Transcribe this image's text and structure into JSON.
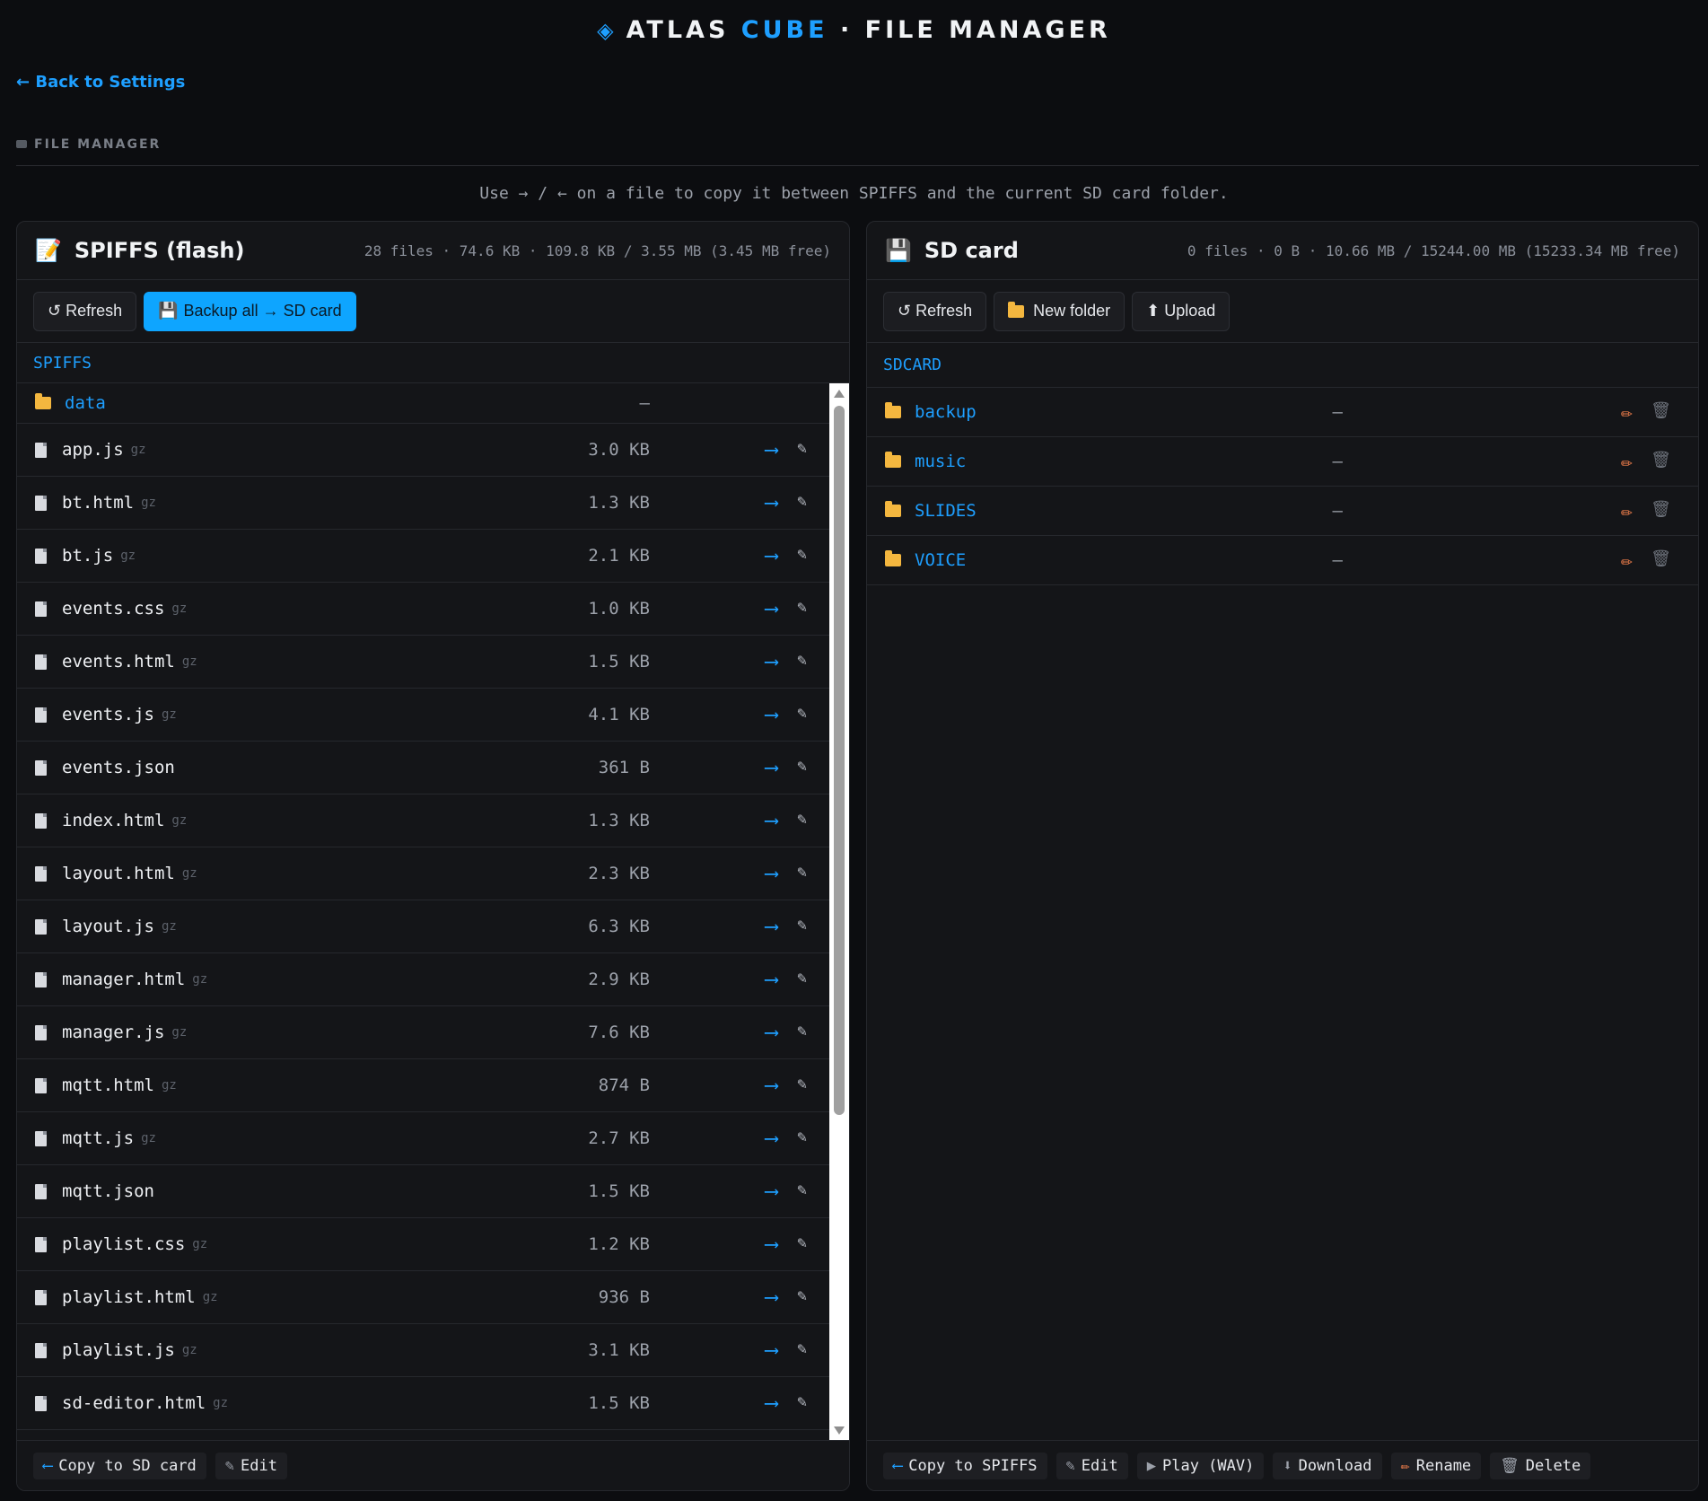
{
  "header": {
    "title_part1": "ATLAS",
    "title_accent": "CUBE",
    "title_part2": "· FILE MANAGER"
  },
  "nav": {
    "back_label": "← Back to Settings"
  },
  "section": {
    "label": "FILE MANAGER"
  },
  "hint": "Use → / ← on a file to copy it between SPIFFS and the current SD card folder.",
  "colors": {
    "accent": "#1e9fff",
    "primary_button": "#0ea5ff",
    "folder": "#f4b73f",
    "rename": "#f07e4b",
    "background": "#0c0d10"
  },
  "spiffs": {
    "title": "SPIFFS (flash)",
    "stats": "28 files · 74.6 KB · 109.8 KB / 3.55 MB (3.45 MB free)",
    "toolbar": {
      "refresh": "↺ Refresh",
      "backup": "Backup all → SD card"
    },
    "path": "SPIFFS",
    "folders": [
      {
        "name": "data",
        "size": "—"
      }
    ],
    "files": [
      {
        "name": "app.js",
        "tag": "gz",
        "size": "3.0 KB"
      },
      {
        "name": "bt.html",
        "tag": "gz",
        "size": "1.3 KB"
      },
      {
        "name": "bt.js",
        "tag": "gz",
        "size": "2.1 KB"
      },
      {
        "name": "events.css",
        "tag": "gz",
        "size": "1.0 KB"
      },
      {
        "name": "events.html",
        "tag": "gz",
        "size": "1.5 KB"
      },
      {
        "name": "events.js",
        "tag": "gz",
        "size": "4.1 KB"
      },
      {
        "name": "events.json",
        "tag": "",
        "size": "361 B"
      },
      {
        "name": "index.html",
        "tag": "gz",
        "size": "1.3 KB"
      },
      {
        "name": "layout.html",
        "tag": "gz",
        "size": "2.3 KB"
      },
      {
        "name": "layout.js",
        "tag": "gz",
        "size": "6.3 KB"
      },
      {
        "name": "manager.html",
        "tag": "gz",
        "size": "2.9 KB"
      },
      {
        "name": "manager.js",
        "tag": "gz",
        "size": "7.6 KB"
      },
      {
        "name": "mqtt.html",
        "tag": "gz",
        "size": "874 B"
      },
      {
        "name": "mqtt.js",
        "tag": "gz",
        "size": "2.7 KB"
      },
      {
        "name": "mqtt.json",
        "tag": "",
        "size": "1.5 KB"
      },
      {
        "name": "playlist.css",
        "tag": "gz",
        "size": "1.2 KB"
      },
      {
        "name": "playlist.html",
        "tag": "gz",
        "size": "936 B"
      },
      {
        "name": "playlist.js",
        "tag": "gz",
        "size": "3.1 KB"
      },
      {
        "name": "sd-editor.html",
        "tag": "gz",
        "size": "1.5 KB"
      }
    ],
    "footer": {
      "copy": "Copy to SD card",
      "edit": "Edit"
    }
  },
  "sdcard": {
    "title": "SD card",
    "stats": "0 files · 0 B · 10.66 MB / 15244.00 MB (15233.34 MB free)",
    "toolbar": {
      "refresh": "↺ Refresh",
      "new_folder": "New folder",
      "upload": "⬆ Upload"
    },
    "path": "SDCARD",
    "folders": [
      {
        "name": "backup",
        "size": "—"
      },
      {
        "name": "music",
        "size": "—"
      },
      {
        "name": "SLIDES",
        "size": "—"
      },
      {
        "name": "VOICE",
        "size": "—"
      }
    ],
    "footer": {
      "copy": "Copy to SPIFFS",
      "edit": "Edit",
      "play": "Play (WAV)",
      "download": "Download",
      "rename": "Rename",
      "delete": "Delete"
    }
  }
}
